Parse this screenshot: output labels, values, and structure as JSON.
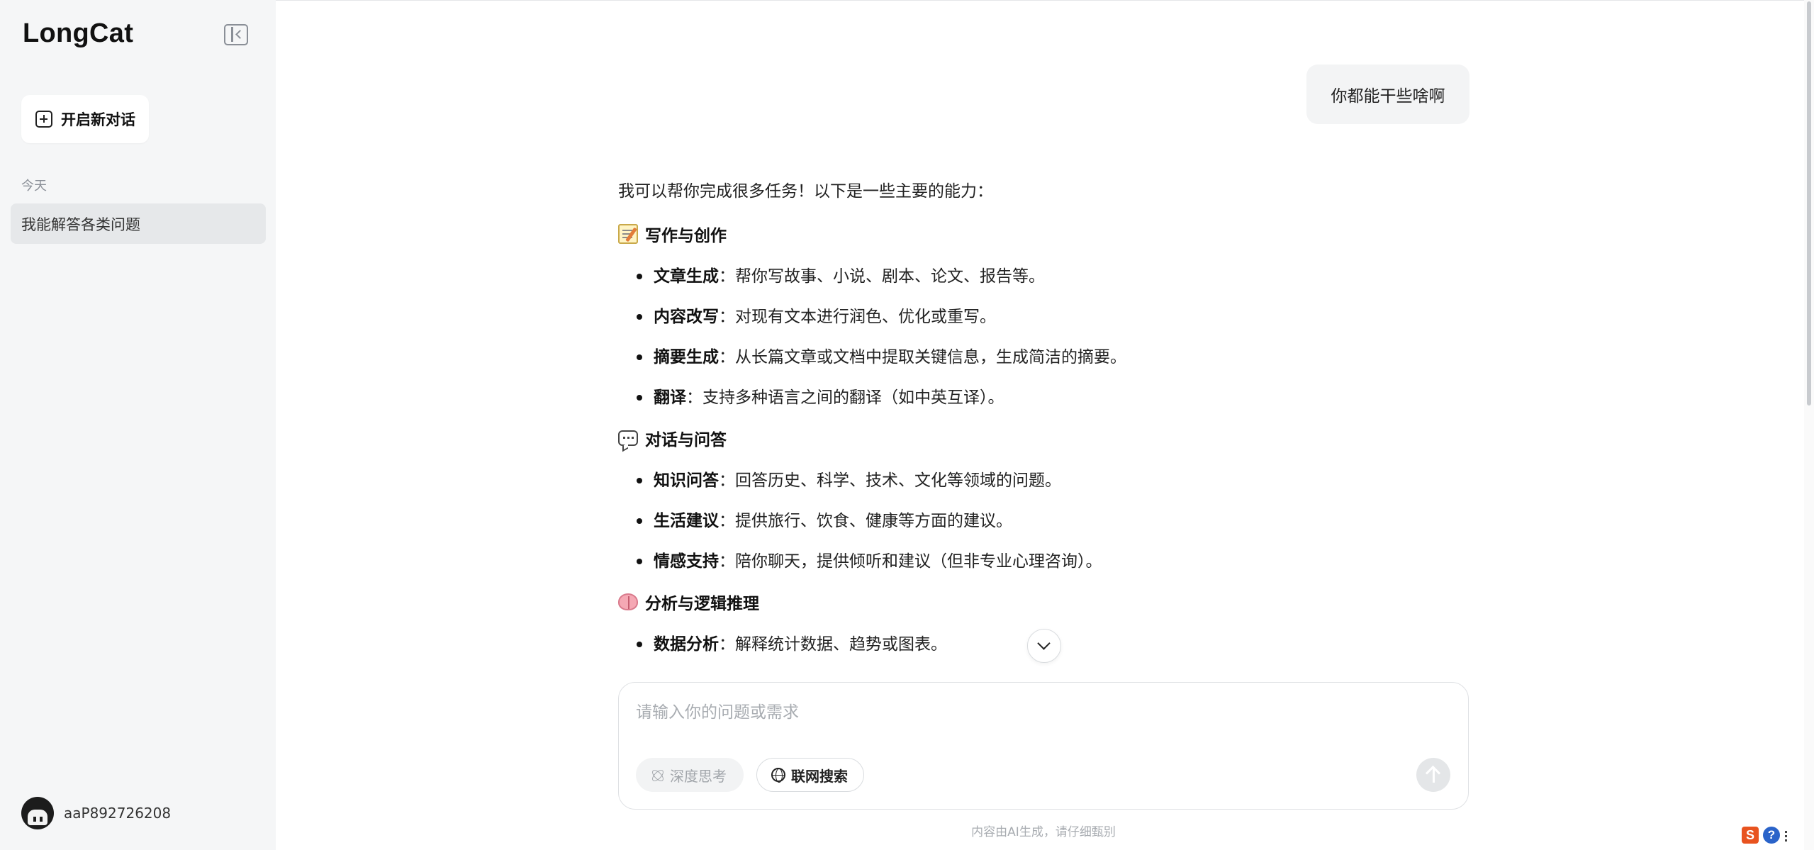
{
  "app": {
    "logo": "LongCat"
  },
  "sidebar": {
    "new_chat_label": "开启新对话",
    "section_label": "今天",
    "history": [
      {
        "label": "我能解答各类问题"
      }
    ],
    "user": {
      "name": "aaP892726208"
    }
  },
  "chat": {
    "user_message": "你都能干些啥啊",
    "answer": {
      "intro": "我可以帮你完成很多任务！以下是一些主要的能力：",
      "sections": [
        {
          "icon": "memo-icon",
          "title": "写作与创作",
          "items": [
            {
              "term": "文章生成",
              "desc": "：帮你写故事、小说、剧本、论文、报告等。"
            },
            {
              "term": "内容改写",
              "desc": "：对现有文本进行润色、优化或重写。"
            },
            {
              "term": "摘要生成",
              "desc": "：从长篇文章或文档中提取关键信息，生成简洁的摘要。"
            },
            {
              "term": "翻译",
              "desc": "：支持多种语言之间的翻译（如中英互译）。"
            }
          ]
        },
        {
          "icon": "speech-bubble-icon",
          "title": "对话与问答",
          "items": [
            {
              "term": "知识问答",
              "desc": "：回答历史、科学、技术、文化等领域的问题。"
            },
            {
              "term": "生活建议",
              "desc": "：提供旅行、饮食、健康等方面的建议。"
            },
            {
              "term": "情感支持",
              "desc": "：陪你聊天，提供倾听和建议（但非专业心理咨询）。"
            }
          ]
        },
        {
          "icon": "brain-icon",
          "title": "分析与逻辑推理",
          "items": [
            {
              "term": "数据分析",
              "desc": "：解释统计数据、趋势或图表。"
            }
          ]
        }
      ]
    }
  },
  "composer": {
    "placeholder": "请输入你的问题或需求",
    "deep_think_label": "深度思考",
    "web_search_label": "联网搜索",
    "disclaimer": "内容由AI生成，请仔细甄别"
  },
  "tray": {
    "ime_label": "S",
    "help_label": "?"
  }
}
